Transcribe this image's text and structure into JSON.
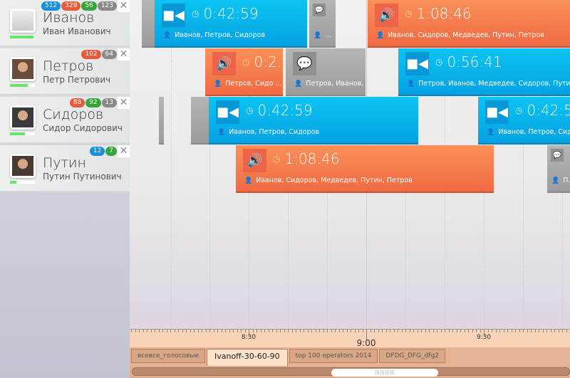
{
  "contacts": [
    {
      "name": "Иванов",
      "patronymic": "Иван Иванович",
      "progress": 0.95,
      "badges": [
        {
          "v": "512",
          "c": "#1a8ed8"
        },
        {
          "v": "329",
          "c": "#e85a3c"
        },
        {
          "v": "56",
          "c": "#35a53c"
        },
        {
          "v": "123",
          "c": "#8a8a8a"
        }
      ],
      "avatar": "placeholder"
    },
    {
      "name": "Петров",
      "patronymic": "Петр Петрович",
      "progress": 0.72,
      "badges": [
        {
          "v": "102",
          "c": "#e85a3c"
        },
        {
          "v": "64",
          "c": "#8a8a8a"
        }
      ],
      "avatar": "photo"
    },
    {
      "name": "Сидоров",
      "patronymic": "Сидор Сидорович",
      "progress": 0.6,
      "badges": [
        {
          "v": "88",
          "c": "#e85a3c"
        },
        {
          "v": "92",
          "c": "#35a53c"
        },
        {
          "v": "13",
          "c": "#8a8a8a"
        }
      ],
      "avatar": "photo"
    },
    {
      "name": "Путин",
      "patronymic": "Путин Путинович",
      "progress": 0.25,
      "badges": [
        {
          "v": "12",
          "c": "#1a8ed8"
        },
        {
          "v": "7",
          "c": "#35a53c"
        }
      ],
      "avatar": "photo"
    }
  ],
  "close_label": "✕",
  "events": [
    {
      "type": "gray",
      "icon": "",
      "dur": "",
      "ppl": ""
    },
    {
      "type": "blue",
      "icon": "video-icon",
      "dur": "0:42:59",
      "ppl": "Иванов, Петров, Сидоров"
    },
    {
      "type": "gray",
      "icon": "chat-icon",
      "dur": "",
      "ppl": "..."
    },
    {
      "type": "orange",
      "icon": "speaker-icon",
      "dur": "1:08:46",
      "ppl": "Иванов, Сидоров, Медведев, Путин, Петров"
    },
    {
      "type": "orange",
      "icon": "speaker-icon",
      "dur": "0:2...",
      "ppl": "Петров, Сидо ..."
    },
    {
      "type": "gray",
      "icon": "chat-icon",
      "dur": "",
      "ppl": "Петров, Иванов, ..."
    },
    {
      "type": "blue",
      "icon": "video-icon",
      "dur": "0:56:41",
      "ppl": "Петров, Иванов, Медведев, Сидоров, Путин"
    },
    {
      "type": "gray",
      "icon": "",
      "dur": "",
      "ppl": ""
    },
    {
      "type": "gray",
      "icon": "",
      "dur": "",
      "ppl": ""
    },
    {
      "type": "blue",
      "icon": "video-icon",
      "dur": "0:42:59",
      "ppl": "Иванов, Петров, Сидоров"
    },
    {
      "type": "blue",
      "icon": "video-icon",
      "dur": "0:42:59",
      "ppl": "Иванов, Петров, Сидоров"
    },
    {
      "type": "orange",
      "icon": "speaker-icon",
      "dur": "1:08:46",
      "ppl": "Иванов, Сидоров, Медведев, Путин, Петров"
    },
    {
      "type": "gray",
      "icon": "chat-icon",
      "dur": "",
      "ppl": "П..."
    }
  ],
  "ruler": {
    "labels": [
      "8:30",
      "9:00",
      "9:30"
    ]
  },
  "tabs": [
    {
      "label": "всевсе_голосовые"
    },
    {
      "label": "Ivanoff-30-60-90",
      "active": true
    },
    {
      "label": "top 100 operators 2014"
    },
    {
      "label": "DFDG_DFG_dfg2"
    }
  ],
  "scroll": {
    "grip": "||||||||||||"
  }
}
